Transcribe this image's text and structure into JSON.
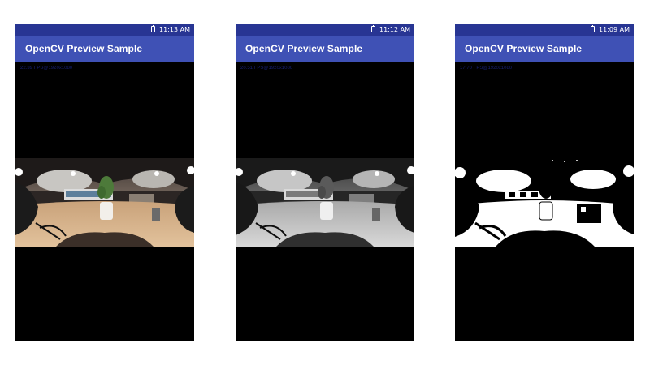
{
  "screens": [
    {
      "time": "11:13 AM",
      "title": "OpenCV Preview Sample",
      "fps": "22.39 FPS@1920x1080",
      "mode": "color"
    },
    {
      "time": "11:12 AM",
      "title": "OpenCV Preview Sample",
      "fps": "20.51 FPS@1920x1080",
      "mode": "grayscale"
    },
    {
      "time": "11:09 AM",
      "title": "OpenCV Preview Sample",
      "fps": "17.70 FPS@1920x1080",
      "mode": "threshold"
    }
  ],
  "colors": {
    "status_bar": "#283593",
    "app_bar": "#3f51b5",
    "background": "#000000"
  }
}
